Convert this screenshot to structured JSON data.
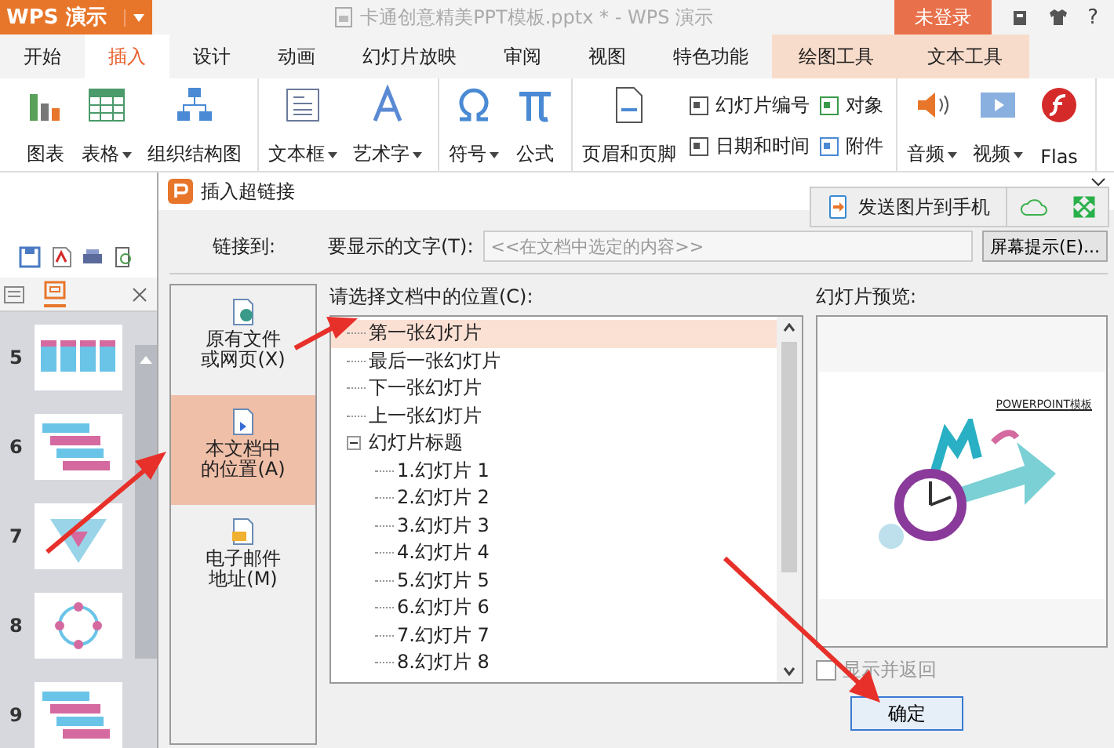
{
  "app_button": {
    "label": "WPS 演示"
  },
  "window": {
    "title": "卡通创意精美PPT模板.pptx * - WPS 演示"
  },
  "login_button": "未登录",
  "help_button": "?",
  "tabs": [
    {
      "label": "开始",
      "selected": false,
      "kind": "normal"
    },
    {
      "label": "插入",
      "selected": true,
      "kind": "normal"
    },
    {
      "label": "设计",
      "selected": false,
      "kind": "normal"
    },
    {
      "label": "动画",
      "selected": false,
      "kind": "normal"
    },
    {
      "label": "幻灯片放映",
      "selected": false,
      "kind": "normal"
    },
    {
      "label": "审阅",
      "selected": false,
      "kind": "normal"
    },
    {
      "label": "视图",
      "selected": false,
      "kind": "normal"
    },
    {
      "label": "特色功能",
      "selected": false,
      "kind": "normal"
    },
    {
      "label": "绘图工具",
      "selected": false,
      "kind": "context"
    },
    {
      "label": "文本工具",
      "selected": false,
      "kind": "context"
    }
  ],
  "ribbon": {
    "groups": [
      {
        "items": [
          {
            "label": "图表",
            "dropdown": false,
            "kind": "large"
          },
          {
            "label": "表格",
            "dropdown": true,
            "kind": "large"
          },
          {
            "label": "组织结构图",
            "dropdown": false,
            "kind": "large"
          }
        ]
      },
      {
        "items": [
          {
            "label": "文本框",
            "dropdown": true,
            "kind": "large"
          },
          {
            "label": "艺术字",
            "dropdown": true,
            "kind": "large"
          }
        ]
      },
      {
        "items": [
          {
            "label": "符号",
            "dropdown": true,
            "kind": "large"
          },
          {
            "label": "公式",
            "dropdown": false,
            "kind": "large"
          }
        ]
      },
      {
        "items": [
          {
            "label": "页眉和页脚",
            "dropdown": false,
            "kind": "large"
          },
          {
            "label": "幻灯片编号",
            "kind": "small"
          },
          {
            "label": "日期和时间",
            "kind": "small"
          },
          {
            "label": "对象",
            "kind": "small"
          },
          {
            "label": "附件",
            "kind": "small"
          }
        ]
      },
      {
        "items": [
          {
            "label": "音频",
            "dropdown": true,
            "kind": "large"
          },
          {
            "label": "视频",
            "dropdown": true,
            "kind": "large"
          },
          {
            "label": "Flas",
            "dropdown": false,
            "kind": "large"
          }
        ]
      }
    ]
  },
  "slides_panel": {
    "thumbnails": [
      {
        "number": "5",
        "kind": "boxes"
      },
      {
        "number": "6",
        "kind": "bars"
      },
      {
        "number": "7",
        "kind": "diamond"
      },
      {
        "number": "8",
        "kind": "ring"
      },
      {
        "number": "9",
        "kind": "bars"
      }
    ]
  },
  "dialog": {
    "title": "插入超链接",
    "link_to_label": "链接到:",
    "display_text_label": "要显示的文字(T):",
    "display_text": {
      "value": "<<在文档中选定的内容>>",
      "disabled": true
    },
    "screen_tip_button": "屏幕提示(E)...",
    "link_targets": [
      {
        "label": "原有文件或网页(X)",
        "selected": false
      },
      {
        "label": "本文档中的位置(A)",
        "selected": true
      },
      {
        "label": "电子邮件地址(M)",
        "selected": false
      }
    ],
    "location_label": "请选择文档中的位置(C):",
    "tree": [
      {
        "label": "第一张幻灯片",
        "selected": true
      },
      {
        "label": "最后一张幻灯片",
        "selected": false
      },
      {
        "label": "下一张幻灯片",
        "selected": false
      },
      {
        "label": "上一张幻灯片",
        "selected": false
      },
      {
        "label": "幻灯片标题",
        "selected": false,
        "expanded": true,
        "children": [
          {
            "label": "1.幻灯片 1",
            "selected": false
          },
          {
            "label": "2.幻灯片 2",
            "selected": false
          },
          {
            "label": "3.幻灯片 3",
            "selected": false
          },
          {
            "label": "4.幻灯片 4",
            "selected": false
          },
          {
            "label": "5.幻灯片 5",
            "selected": false
          },
          {
            "label": "6.幻灯片 6",
            "selected": false
          },
          {
            "label": "7.幻灯片 7",
            "selected": false
          },
          {
            "label": "8.幻灯片 8",
            "selected": false
          }
        ]
      }
    ],
    "preview_label": "幻灯片预览:",
    "preview_title": "POWERPOINT模板",
    "show_and_return": {
      "label": "显示并返回",
      "checked": false
    },
    "ok_button": "确定"
  },
  "float_toolbar": {
    "send_label": "发送图片到手机"
  }
}
